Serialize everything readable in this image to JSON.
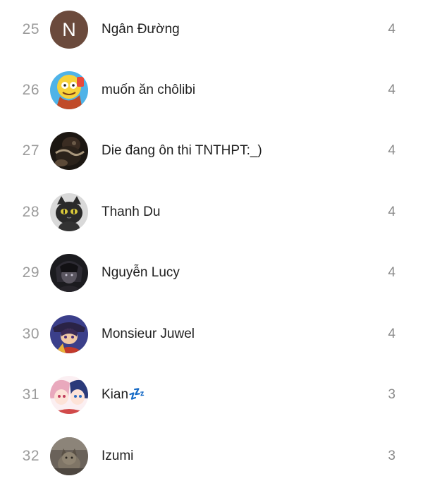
{
  "rows": [
    {
      "rank": "25",
      "name": "Ngân Đường",
      "score": "4",
      "avatar_letter": "N",
      "avatar_color": "#6b4a3c"
    },
    {
      "rank": "26",
      "name": "muốn ăn chôlibi",
      "score": "4",
      "avatar_icon": "cartoon-avatar-icon"
    },
    {
      "rank": "27",
      "name": "Die đang ôn thi TNTHPT:_)",
      "score": "4",
      "avatar_icon": "photo-avatar-icon"
    },
    {
      "rank": "28",
      "name": "Thanh Du",
      "score": "4",
      "avatar_icon": "black-cat-avatar-icon"
    },
    {
      "rank": "29",
      "name": "Nguyễn Lucy",
      "score": "4",
      "avatar_icon": "dark-anime-avatar-icon"
    },
    {
      "rank": "30",
      "name": "Monsieur Juwel",
      "score": "4",
      "avatar_icon": "anime-character-avatar-icon"
    },
    {
      "rank": "31",
      "name": "Kian💤",
      "score": "3",
      "avatar_icon": "anime-duo-avatar-icon"
    },
    {
      "rank": "32",
      "name": "Izumi",
      "score": "3",
      "avatar_icon": "cat-photo-avatar-icon"
    }
  ]
}
